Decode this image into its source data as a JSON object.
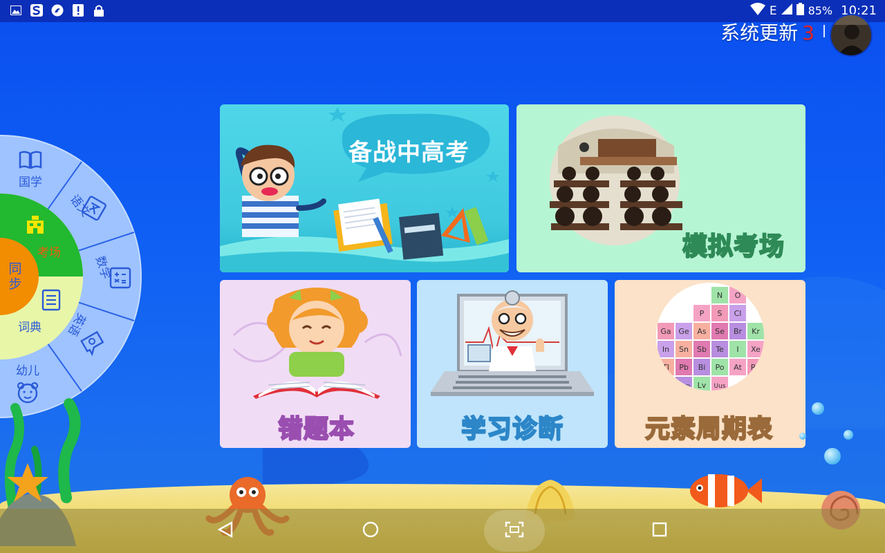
{
  "status_bar": {
    "left_icons": [
      "image-icon",
      "s-app-icon",
      "swirl-icon",
      "alert-icon",
      "lock-icon"
    ],
    "network": "E",
    "battery": "85%",
    "time": "10:21"
  },
  "header": {
    "update_label": "系统更新",
    "update_count": "3"
  },
  "wheel": {
    "center_label": "同步",
    "items": [
      {
        "label": "国学",
        "icon": "book-icon"
      },
      {
        "label": "语文",
        "icon": "chinese-icon"
      },
      {
        "label": "数学",
        "icon": "math-icon"
      },
      {
        "label": "英语",
        "icon": "english-icon"
      },
      {
        "label": "幼儿",
        "icon": "bear-face-icon"
      }
    ],
    "active_items": [
      {
        "label": "考场",
        "icon": "building-icon"
      },
      {
        "label": "词典",
        "icon": "dictionary-icon"
      }
    ]
  },
  "cards": {
    "exam_prep": {
      "title": "备战中高考"
    },
    "mock_exam": {
      "label": "模拟考场"
    },
    "wrong_questions": {
      "label": "错题本"
    },
    "diagnosis": {
      "label": "学习诊断"
    },
    "periodic_table": {
      "label": "元素周期表",
      "elements": [
        "N",
        "O",
        "P",
        "S",
        "Cl",
        "Ga",
        "Ge",
        "As",
        "Se",
        "Br",
        "Kr",
        "In",
        "Sn",
        "Sb",
        "Te",
        "I",
        "Xe",
        "Tl",
        "Pb",
        "Bi",
        "Po",
        "At",
        "Rn",
        "Fl",
        "Uup",
        "Lv",
        "Uus"
      ]
    }
  },
  "nav": {
    "buttons": [
      "back-icon",
      "home-icon",
      "screenshot-icon",
      "recents-icon"
    ]
  },
  "colors": {
    "accent_red": "#e8242b",
    "status_bar": "#0b2fb8",
    "background": "#1060f4"
  }
}
